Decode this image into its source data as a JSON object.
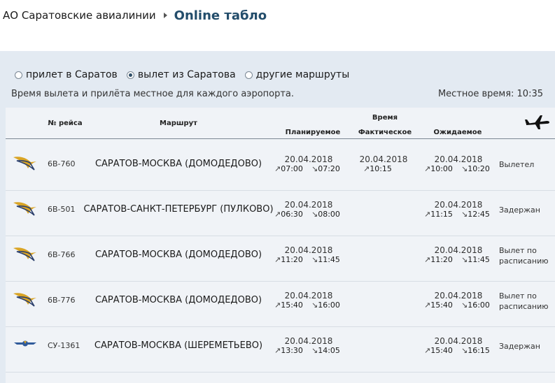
{
  "breadcrumb": {
    "parent": "АО Саратовские авиалинии",
    "title": "Online табло"
  },
  "filters": {
    "options": [
      {
        "label": "прилет в Саратов",
        "selected": false
      },
      {
        "label": "вылет из Саратова",
        "selected": true
      },
      {
        "label": "другие маршруты",
        "selected": false
      }
    ]
  },
  "note": "Время вылета и прилёта местное для каждого аэропорта.",
  "local_time": "Местное время:  10:35",
  "table": {
    "headers": {
      "flight": "№ рейса",
      "route": "Маршрут",
      "time_group": "Время",
      "planned": "Планируемое",
      "actual": "Фактическое",
      "expected": "Ожидаемое"
    },
    "icons": {
      "header": "airplane-icon",
      "dep_arrow": "↗",
      "arr_arrow": "↘"
    },
    "rows": [
      {
        "logo": "saratov-airlines-logo",
        "flight": "6В-760",
        "route": "САРАТОВ-МОСКВА (ДОМОДЕДОВО)",
        "planned": {
          "date": "20.04.2018",
          "dep": "07:00",
          "arr": "07:20"
        },
        "actual": {
          "date": "20.04.2018",
          "dep": "10:15"
        },
        "expected": {
          "date": "20.04.2018",
          "dep": "10:00",
          "arr": "10:20"
        },
        "status": "Вылетел"
      },
      {
        "logo": "saratov-airlines-logo",
        "flight": "6В-501",
        "route": "САРАТОВ-САНКТ-ПЕТЕРБУРГ (ПУЛКОВО)",
        "planned": {
          "date": "20.04.2018",
          "dep": "06:30",
          "arr": "08:00"
        },
        "actual": null,
        "expected": {
          "date": "20.04.2018",
          "dep": "11:15",
          "arr": "12:45"
        },
        "status": "Задержан"
      },
      {
        "logo": "saratov-airlines-logo",
        "flight": "6В-766",
        "route": "САРАТОВ-МОСКВА (ДОМОДЕДОВО)",
        "planned": {
          "date": "20.04.2018",
          "dep": "11:20",
          "arr": "11:45"
        },
        "actual": null,
        "expected": {
          "date": "20.04.2018",
          "dep": "11:20",
          "arr": "11:45"
        },
        "status": "Вылет по расписанию"
      },
      {
        "logo": "saratov-airlines-logo",
        "flight": "6В-776",
        "route": "САРАТОВ-МОСКВА (ДОМОДЕДОВО)",
        "planned": {
          "date": "20.04.2018",
          "dep": "15:40",
          "arr": "16:00"
        },
        "actual": null,
        "expected": {
          "date": "20.04.2018",
          "dep": "15:40",
          "arr": "16:00"
        },
        "status": "Вылет по расписанию"
      },
      {
        "logo": "aeroflot-logo",
        "flight": "СУ-1361",
        "route": "САРАТОВ-МОСКВА (ШЕРЕМЕТЬЕВО)",
        "planned": {
          "date": "20.04.2018",
          "dep": "13:30",
          "arr": "14:05"
        },
        "actual": null,
        "expected": {
          "date": "20.04.2018",
          "dep": "15:40",
          "arr": "16:15"
        },
        "status": "Задержан"
      }
    ]
  },
  "colors": {
    "panel_bg": "#e3eaf2",
    "board_bg": "#f0f3f7",
    "title": "#234d6b",
    "saratov_logo_gold": "#d9a425",
    "saratov_logo_navy": "#2b3f6b",
    "aeroflot_blue": "#2f5a9a"
  }
}
